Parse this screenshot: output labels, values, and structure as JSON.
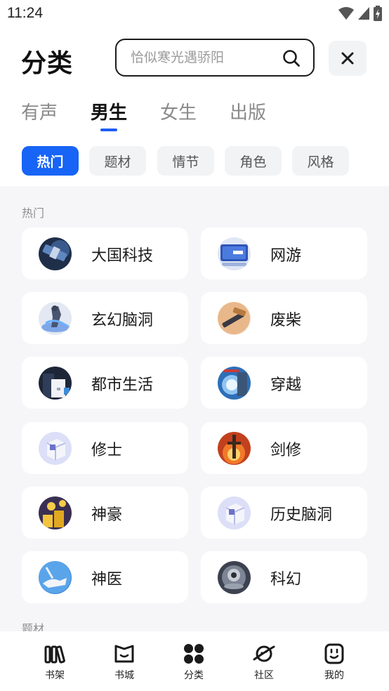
{
  "status_bar": {
    "time": "11:24"
  },
  "header": {
    "title": "分类",
    "search_placeholder": "恰似寒光遇骄阳"
  },
  "tabs": [
    {
      "label": "有声",
      "active": false
    },
    {
      "label": "男生",
      "active": true
    },
    {
      "label": "女生",
      "active": false
    },
    {
      "label": "出版",
      "active": false
    }
  ],
  "chips": [
    {
      "label": "热门",
      "active": true
    },
    {
      "label": "题材",
      "active": false
    },
    {
      "label": "情节",
      "active": false
    },
    {
      "label": "角色",
      "active": false
    },
    {
      "label": "风格",
      "active": false
    }
  ],
  "sections": {
    "hot": "热门",
    "theme": "题材"
  },
  "categories": [
    {
      "label": "大国科技",
      "icon": "satellite-icon"
    },
    {
      "label": "网游",
      "icon": "game-screen-icon"
    },
    {
      "label": "玄幻脑洞",
      "icon": "fantasy-figure-icon"
    },
    {
      "label": "废柴",
      "icon": "broken-wood-icon"
    },
    {
      "label": "都市生活",
      "icon": "city-icon"
    },
    {
      "label": "穿越",
      "icon": "portal-icon"
    },
    {
      "label": "修士",
      "icon": "cube-icon"
    },
    {
      "label": "剑修",
      "icon": "sword-icon"
    },
    {
      "label": "神豪",
      "icon": "gold-coins-icon"
    },
    {
      "label": "历史脑洞",
      "icon": "cube-icon"
    },
    {
      "label": "神医",
      "icon": "healing-hand-icon"
    },
    {
      "label": "科幻",
      "icon": "alien-planet-icon"
    }
  ],
  "bottom_nav": [
    {
      "label": "书架",
      "icon": "bookshelf-icon"
    },
    {
      "label": "书城",
      "icon": "bookstore-icon"
    },
    {
      "label": "分类",
      "icon": "category-icon"
    },
    {
      "label": "社区",
      "icon": "community-planet-icon"
    },
    {
      "label": "我的",
      "icon": "profile-face-icon"
    }
  ],
  "colors": {
    "accent": "#1764f6",
    "indicator": "#1d5cf5",
    "chip_bg": "#f2f3f5",
    "content_bg": "#f6f6f8"
  }
}
